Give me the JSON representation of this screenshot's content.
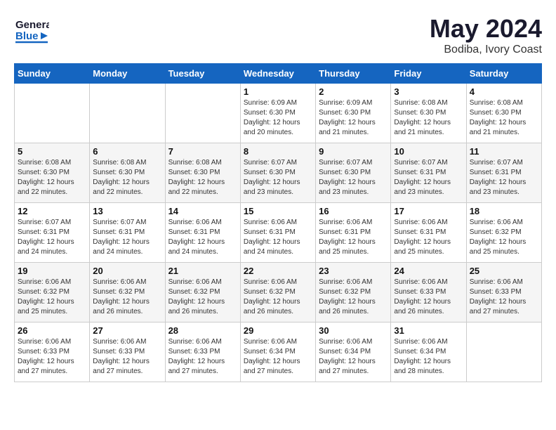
{
  "app": {
    "logo_general": "General",
    "logo_blue": "Blue",
    "title": "May 2024",
    "subtitle": "Bodiba, Ivory Coast"
  },
  "calendar": {
    "headers": [
      "Sunday",
      "Monday",
      "Tuesday",
      "Wednesday",
      "Thursday",
      "Friday",
      "Saturday"
    ],
    "weeks": [
      [
        {
          "day": "",
          "sunrise": "",
          "sunset": "",
          "daylight": ""
        },
        {
          "day": "",
          "sunrise": "",
          "sunset": "",
          "daylight": ""
        },
        {
          "day": "",
          "sunrise": "",
          "sunset": "",
          "daylight": ""
        },
        {
          "day": "1",
          "sunrise": "Sunrise: 6:09 AM",
          "sunset": "Sunset: 6:30 PM",
          "daylight": "Daylight: 12 hours and 20 minutes."
        },
        {
          "day": "2",
          "sunrise": "Sunrise: 6:09 AM",
          "sunset": "Sunset: 6:30 PM",
          "daylight": "Daylight: 12 hours and 21 minutes."
        },
        {
          "day": "3",
          "sunrise": "Sunrise: 6:08 AM",
          "sunset": "Sunset: 6:30 PM",
          "daylight": "Daylight: 12 hours and 21 minutes."
        },
        {
          "day": "4",
          "sunrise": "Sunrise: 6:08 AM",
          "sunset": "Sunset: 6:30 PM",
          "daylight": "Daylight: 12 hours and 21 minutes."
        }
      ],
      [
        {
          "day": "5",
          "sunrise": "Sunrise: 6:08 AM",
          "sunset": "Sunset: 6:30 PM",
          "daylight": "Daylight: 12 hours and 22 minutes."
        },
        {
          "day": "6",
          "sunrise": "Sunrise: 6:08 AM",
          "sunset": "Sunset: 6:30 PM",
          "daylight": "Daylight: 12 hours and 22 minutes."
        },
        {
          "day": "7",
          "sunrise": "Sunrise: 6:08 AM",
          "sunset": "Sunset: 6:30 PM",
          "daylight": "Daylight: 12 hours and 22 minutes."
        },
        {
          "day": "8",
          "sunrise": "Sunrise: 6:07 AM",
          "sunset": "Sunset: 6:30 PM",
          "daylight": "Daylight: 12 hours and 23 minutes."
        },
        {
          "day": "9",
          "sunrise": "Sunrise: 6:07 AM",
          "sunset": "Sunset: 6:30 PM",
          "daylight": "Daylight: 12 hours and 23 minutes."
        },
        {
          "day": "10",
          "sunrise": "Sunrise: 6:07 AM",
          "sunset": "Sunset: 6:31 PM",
          "daylight": "Daylight: 12 hours and 23 minutes."
        },
        {
          "day": "11",
          "sunrise": "Sunrise: 6:07 AM",
          "sunset": "Sunset: 6:31 PM",
          "daylight": "Daylight: 12 hours and 23 minutes."
        }
      ],
      [
        {
          "day": "12",
          "sunrise": "Sunrise: 6:07 AM",
          "sunset": "Sunset: 6:31 PM",
          "daylight": "Daylight: 12 hours and 24 minutes."
        },
        {
          "day": "13",
          "sunrise": "Sunrise: 6:07 AM",
          "sunset": "Sunset: 6:31 PM",
          "daylight": "Daylight: 12 hours and 24 minutes."
        },
        {
          "day": "14",
          "sunrise": "Sunrise: 6:06 AM",
          "sunset": "Sunset: 6:31 PM",
          "daylight": "Daylight: 12 hours and 24 minutes."
        },
        {
          "day": "15",
          "sunrise": "Sunrise: 6:06 AM",
          "sunset": "Sunset: 6:31 PM",
          "daylight": "Daylight: 12 hours and 24 minutes."
        },
        {
          "day": "16",
          "sunrise": "Sunrise: 6:06 AM",
          "sunset": "Sunset: 6:31 PM",
          "daylight": "Daylight: 12 hours and 25 minutes."
        },
        {
          "day": "17",
          "sunrise": "Sunrise: 6:06 AM",
          "sunset": "Sunset: 6:31 PM",
          "daylight": "Daylight: 12 hours and 25 minutes."
        },
        {
          "day": "18",
          "sunrise": "Sunrise: 6:06 AM",
          "sunset": "Sunset: 6:32 PM",
          "daylight": "Daylight: 12 hours and 25 minutes."
        }
      ],
      [
        {
          "day": "19",
          "sunrise": "Sunrise: 6:06 AM",
          "sunset": "Sunset: 6:32 PM",
          "daylight": "Daylight: 12 hours and 25 minutes."
        },
        {
          "day": "20",
          "sunrise": "Sunrise: 6:06 AM",
          "sunset": "Sunset: 6:32 PM",
          "daylight": "Daylight: 12 hours and 26 minutes."
        },
        {
          "day": "21",
          "sunrise": "Sunrise: 6:06 AM",
          "sunset": "Sunset: 6:32 PM",
          "daylight": "Daylight: 12 hours and 26 minutes."
        },
        {
          "day": "22",
          "sunrise": "Sunrise: 6:06 AM",
          "sunset": "Sunset: 6:32 PM",
          "daylight": "Daylight: 12 hours and 26 minutes."
        },
        {
          "day": "23",
          "sunrise": "Sunrise: 6:06 AM",
          "sunset": "Sunset: 6:32 PM",
          "daylight": "Daylight: 12 hours and 26 minutes."
        },
        {
          "day": "24",
          "sunrise": "Sunrise: 6:06 AM",
          "sunset": "Sunset: 6:33 PM",
          "daylight": "Daylight: 12 hours and 26 minutes."
        },
        {
          "day": "25",
          "sunrise": "Sunrise: 6:06 AM",
          "sunset": "Sunset: 6:33 PM",
          "daylight": "Daylight: 12 hours and 27 minutes."
        }
      ],
      [
        {
          "day": "26",
          "sunrise": "Sunrise: 6:06 AM",
          "sunset": "Sunset: 6:33 PM",
          "daylight": "Daylight: 12 hours and 27 minutes."
        },
        {
          "day": "27",
          "sunrise": "Sunrise: 6:06 AM",
          "sunset": "Sunset: 6:33 PM",
          "daylight": "Daylight: 12 hours and 27 minutes."
        },
        {
          "day": "28",
          "sunrise": "Sunrise: 6:06 AM",
          "sunset": "Sunset: 6:33 PM",
          "daylight": "Daylight: 12 hours and 27 minutes."
        },
        {
          "day": "29",
          "sunrise": "Sunrise: 6:06 AM",
          "sunset": "Sunset: 6:34 PM",
          "daylight": "Daylight: 12 hours and 27 minutes."
        },
        {
          "day": "30",
          "sunrise": "Sunrise: 6:06 AM",
          "sunset": "Sunset: 6:34 PM",
          "daylight": "Daylight: 12 hours and 27 minutes."
        },
        {
          "day": "31",
          "sunrise": "Sunrise: 6:06 AM",
          "sunset": "Sunset: 6:34 PM",
          "daylight": "Daylight: 12 hours and 28 minutes."
        },
        {
          "day": "",
          "sunrise": "",
          "sunset": "",
          "daylight": ""
        }
      ]
    ]
  }
}
